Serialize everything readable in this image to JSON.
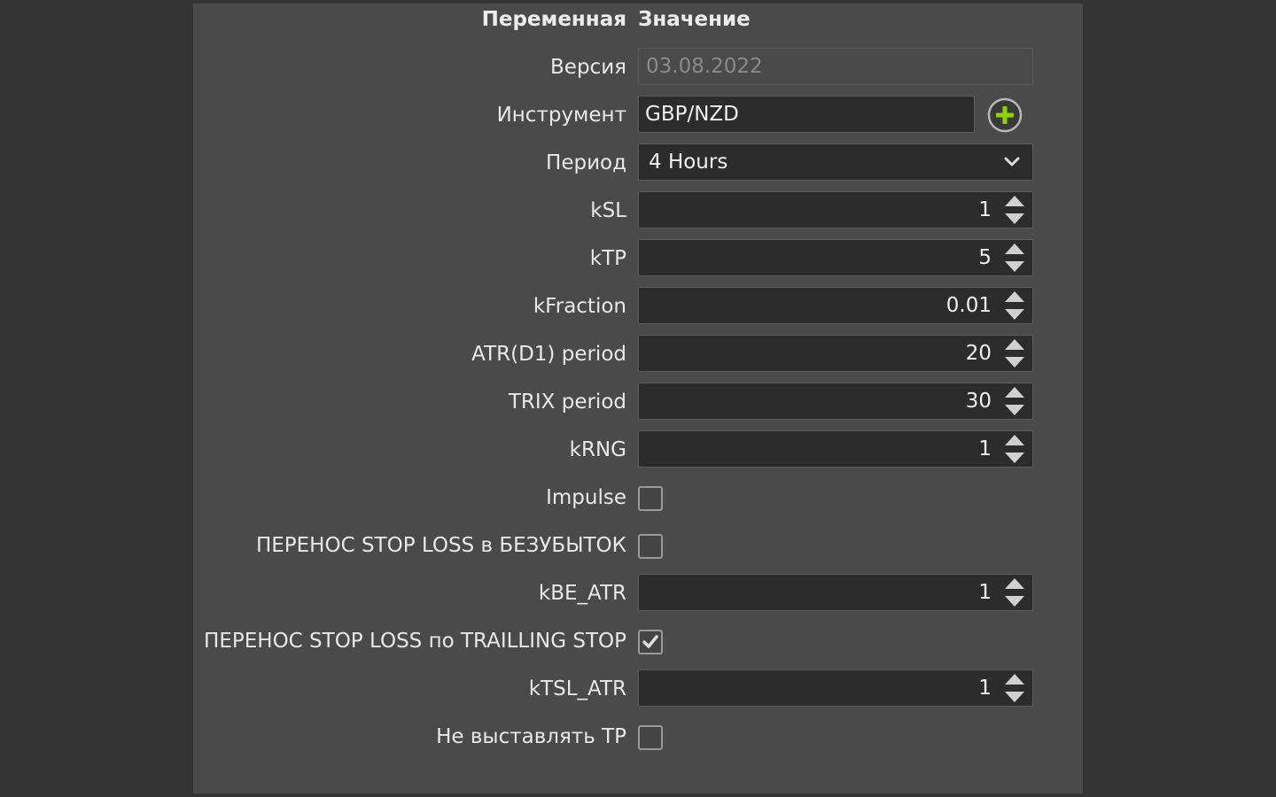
{
  "header": {
    "variable": "Переменная",
    "value": "Значение"
  },
  "rows": {
    "version": {
      "label": "Версия",
      "value": "03.08.2022"
    },
    "instrument": {
      "label": "Инструмент",
      "value": "GBP/NZD",
      "add_icon": "plus-circle-icon"
    },
    "period": {
      "label": "Период",
      "value": "4 Hours"
    },
    "ksl": {
      "label": "kSL",
      "value": "1"
    },
    "ktp": {
      "label": "kTP",
      "value": "5"
    },
    "kfraction": {
      "label": "kFraction",
      "value": "0.01"
    },
    "atr_period": {
      "label": "ATR(D1) period",
      "value": "20"
    },
    "trix_period": {
      "label": "TRIX period",
      "value": "30"
    },
    "krng": {
      "label": "kRNG",
      "value": "1"
    },
    "impulse": {
      "label": "Impulse",
      "checked": false
    },
    "breakeven": {
      "label": "ПЕРЕНОС STOP LOSS в БЕЗУБЫТОК",
      "checked": false
    },
    "kbe_atr": {
      "label": "kBE_ATR",
      "value": "1"
    },
    "trailing": {
      "label": "ПЕРЕНОС STOP LOSS по TRAILLING STOP",
      "checked": true
    },
    "ktsl_atr": {
      "label": "kTSL_ATR",
      "value": "1"
    },
    "no_tp": {
      "label": "Не выставлять TP",
      "checked": false
    }
  },
  "colors": {
    "panel": "#4a4a4a",
    "background": "#333333",
    "field": "#2c2c2c",
    "accent_green": "#8fd400"
  }
}
